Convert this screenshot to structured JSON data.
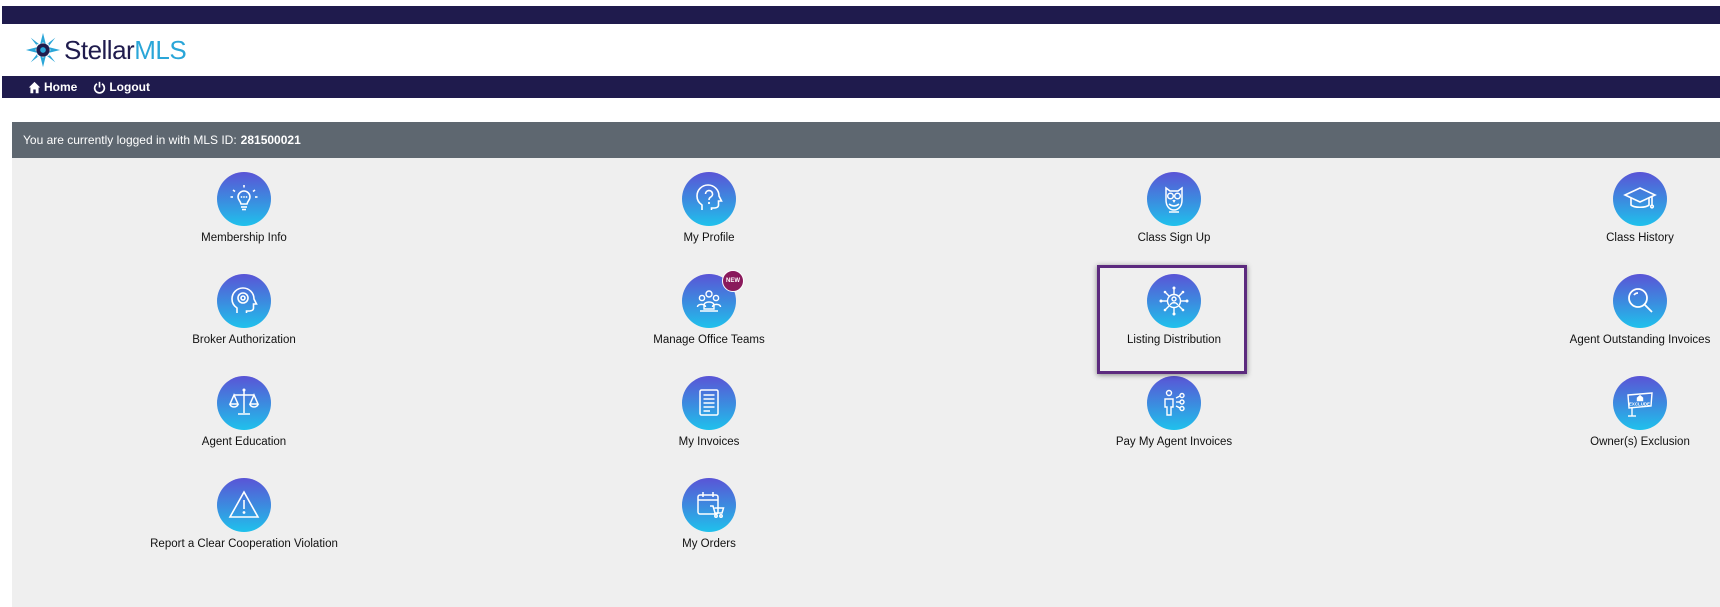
{
  "brand": {
    "name": "Stellar",
    "suffix": "MLS",
    "logo_icon": "star-burst-logo"
  },
  "nav": {
    "home_label": "Home",
    "logout_label": "Logout"
  },
  "login": {
    "prefix": "You are currently logged in with MLS ID:",
    "mls_id": "281500021"
  },
  "tiles": [
    {
      "label": "Membership Info",
      "icon": "lightbulb-icon"
    },
    {
      "label": "My Profile",
      "icon": "question-head-icon"
    },
    {
      "label": "Class Sign Up",
      "icon": "owl-icon"
    },
    {
      "label": "Class History",
      "icon": "graduation-cap-icon"
    },
    {
      "label": "Broker Authorization",
      "icon": "head-gear-icon"
    },
    {
      "label": "Manage Office Teams",
      "icon": "team-icon",
      "badge": "NEW"
    },
    {
      "label": "Listing Distribution",
      "icon": "distribution-network-icon"
    },
    {
      "label": "Agent Outstanding Invoices",
      "icon": "magnifier-icon"
    },
    {
      "label": "Agent Education",
      "icon": "scales-icon"
    },
    {
      "label": "My Invoices",
      "icon": "document-icon"
    },
    {
      "label": "Pay My Agent Invoices",
      "icon": "person-flow-icon"
    },
    {
      "label": "Owner(s) Exclusion",
      "icon": "exclude-sign-icon",
      "icon_text": "EXCLUDE"
    },
    {
      "label": "Report a Clear Cooperation Violation",
      "icon": "warning-icon"
    },
    {
      "label": "My Orders",
      "icon": "calendar-cart-icon"
    }
  ],
  "colors": {
    "navy": "#1f1b4d",
    "accent": "#2aa6d8",
    "login_bar": "#5e6770",
    "highlight": "#5c2a7e",
    "badge": "#8a1a5c"
  }
}
